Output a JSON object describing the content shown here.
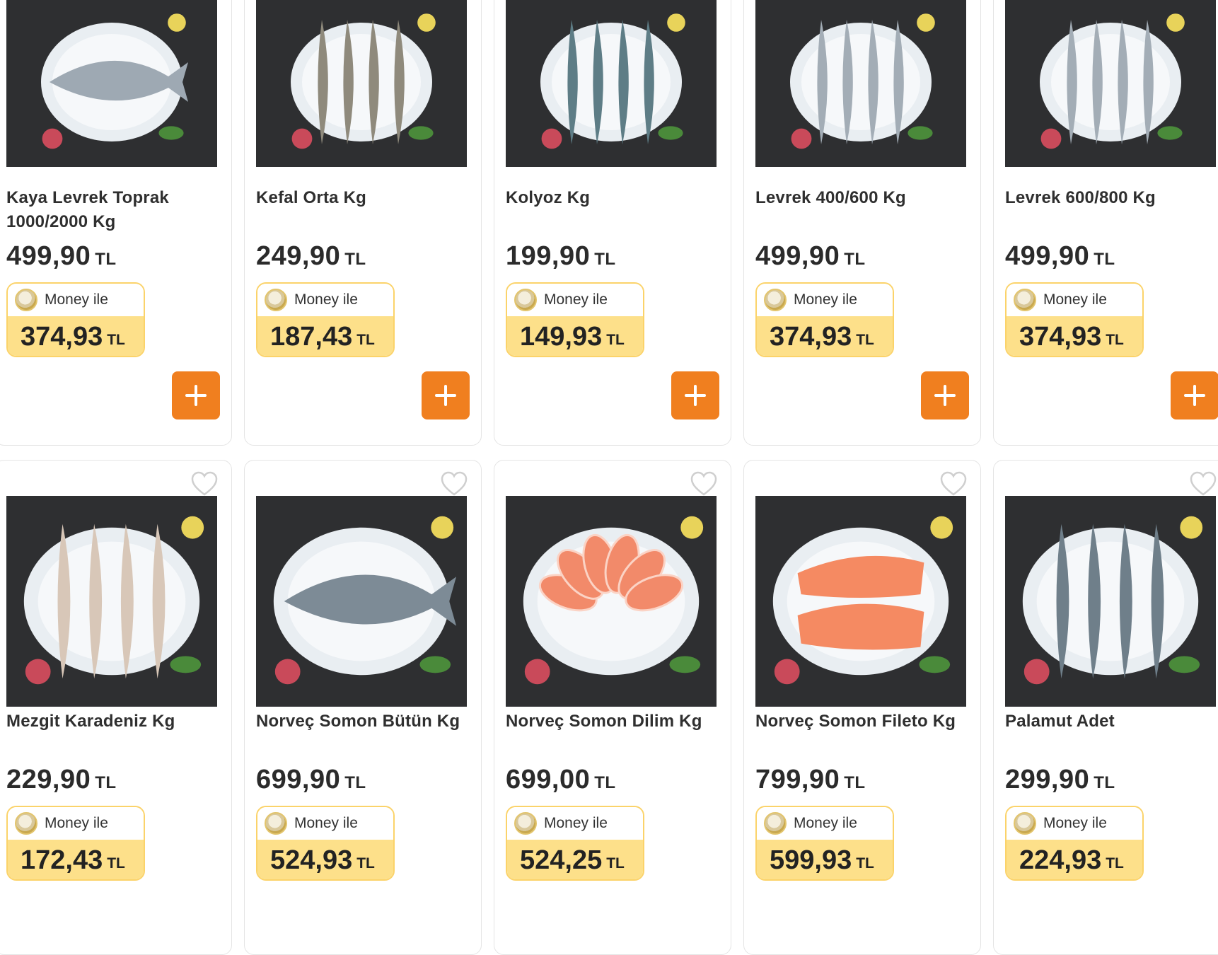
{
  "products": [
    {
      "name": "Kaya Levrek Toprak 1000/2000 Kg",
      "price": "499,90",
      "money_price": "374,93",
      "image": "whole-fish-on-ice",
      "accent": "#9ea9b3",
      "favorite": "heart-outline-icon"
    },
    {
      "name": "Kefal Orta Kg",
      "price": "249,90",
      "money_price": "187,43",
      "image": "mullet-fish-on-ice",
      "accent": "#8f8a7c"
    },
    {
      "name": "Kolyoz Kg",
      "price": "199,90",
      "money_price": "149,93",
      "image": "mackerel-on-ice",
      "accent": "#5e7d86"
    },
    {
      "name": "Levrek 400/600 Kg",
      "price": "499,90",
      "money_price": "374,93",
      "image": "sea-bass-on-ice",
      "accent": "#a3adb6"
    },
    {
      "name": "Levrek 600/800 Kg",
      "price": "499,90",
      "money_price": "374,93",
      "image": "sea-bass-on-ice",
      "accent": "#a3adb6"
    },
    {
      "name": "Mezgit Karadeniz Kg",
      "price": "229,90",
      "money_price": "172,43",
      "image": "whiting-fish-on-ice",
      "accent": "#d8c7b8"
    },
    {
      "name": "Norveç Somon Bütün Kg",
      "price": "699,90",
      "money_price": "524,93",
      "image": "whole-salmon-on-ice",
      "accent": "#7d8b96"
    },
    {
      "name": "Norveç Somon Dilim Kg",
      "price": "699,00",
      "money_price": "524,25",
      "image": "salmon-steaks-on-ice",
      "accent": "#f28a6a"
    },
    {
      "name": "Norveç Somon Fileto Kg",
      "price": "799,90",
      "money_price": "599,93",
      "image": "salmon-fillet-on-ice",
      "accent": "#f58a62"
    },
    {
      "name": "Palamut Adet",
      "price": "299,90",
      "money_price": "224,93",
      "image": "bonito-fish-on-ice",
      "accent": "#6f7f8a"
    }
  ],
  "currency": "TL",
  "money_label": "Money ile",
  "colors": {
    "add_button": "#f07f1f",
    "money_badge_bg": "#fde08a",
    "money_badge_border": "#fbd36a"
  }
}
